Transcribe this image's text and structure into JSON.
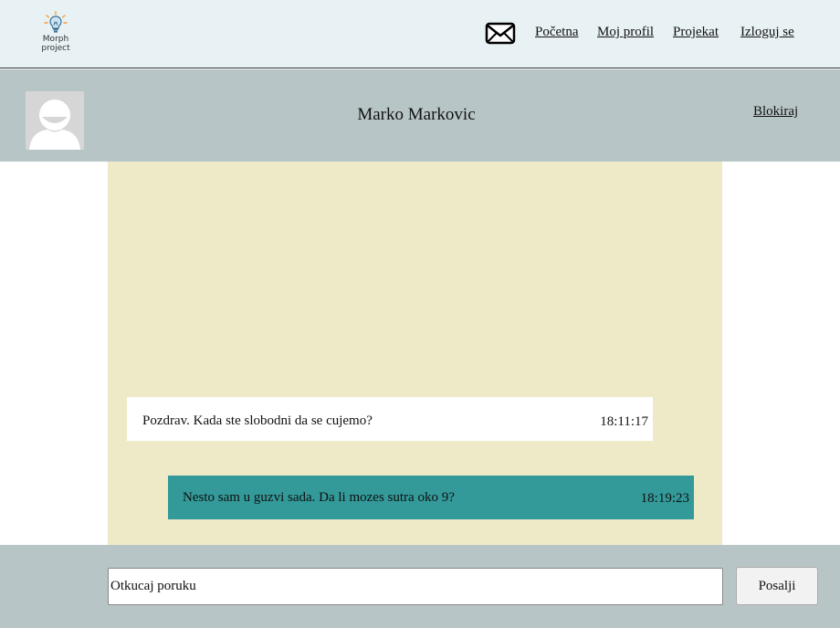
{
  "header": {
    "logo_line1": "Morph",
    "logo_line2": "project",
    "mail_icon": "envelope-icon",
    "nav": {
      "home": "Početna",
      "profile": "Moj profil",
      "project": "Projekat",
      "logout": "Izloguj se"
    }
  },
  "chat": {
    "contact_name": "Marko Markovic",
    "block_label": "Blokiraj",
    "avatar_icon": "default-user-avatar-icon",
    "messages": [
      {
        "direction": "incoming",
        "text": "Pozdrav. Kada ste slobodni da se cujemo?",
        "time": "18:11:17"
      },
      {
        "direction": "outgoing",
        "text": "Nesto sam u guzvi sada. Da li mozes sutra oko 9?",
        "time": "18:19:23"
      }
    ]
  },
  "composer": {
    "input_value": "Otkucaj poruku",
    "send_label": "Posalji"
  },
  "colors": {
    "topbar_bg": "#e8f2f5",
    "header_bg": "#b8c5c6",
    "messages_bg": "#eeeac7",
    "incoming_bubble": "#ffffff",
    "outgoing_bubble": "#339999"
  }
}
